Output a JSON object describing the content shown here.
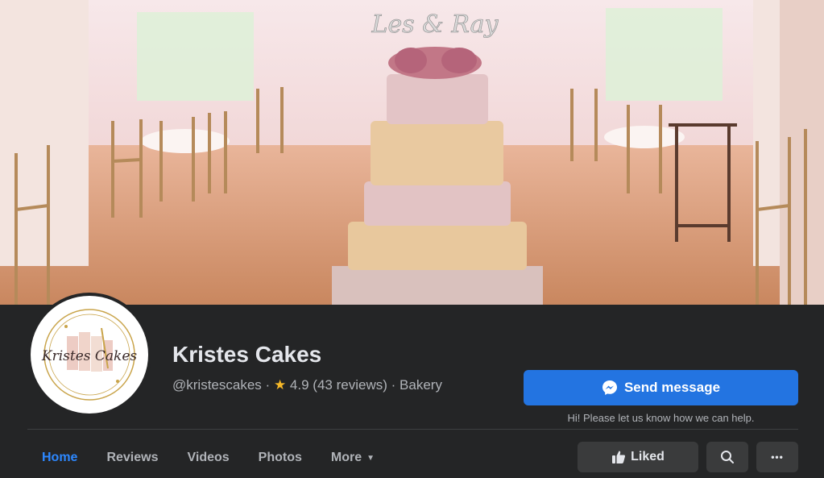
{
  "cover": {
    "cake_topper_text": "Les & Ray"
  },
  "page": {
    "avatar_logo_text": "Kristes Cakes",
    "name": "Kristes Cakes",
    "handle": "@kristescakes",
    "separator": "·",
    "rating": "4.9",
    "reviews": "(43 reviews)",
    "category": "Bakery"
  },
  "cta": {
    "send_label": "Send message",
    "help_text": "Hi! Please let us know how we can help."
  },
  "tabs": [
    {
      "label": "Home",
      "active": true
    },
    {
      "label": "Reviews"
    },
    {
      "label": "Videos"
    },
    {
      "label": "Photos"
    },
    {
      "label": "More"
    }
  ],
  "actions": {
    "liked_label": "Liked",
    "more_label": "•••"
  },
  "icons": [
    "messenger-icon",
    "star-icon",
    "thumbs-up-icon",
    "search-icon",
    "chevron-down-icon"
  ],
  "colors": {
    "background": "#242526",
    "accent": "#2374e1",
    "active_tab": "#2d88ff",
    "star": "#f7b928"
  }
}
